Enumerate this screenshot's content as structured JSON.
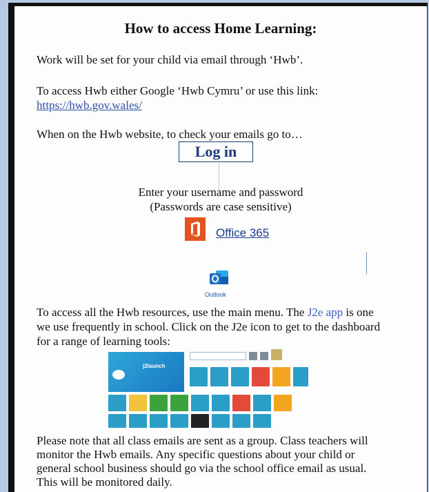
{
  "doc": {
    "title": "How to access Home Learning:",
    "para1": "Work will be set for your child via email through ‘Hwb’.",
    "para2": "To access Hwb either Google ‘Hwb Cymru’ or use this link:",
    "link": "https://hwb.gov.wales/",
    "para3": "When on the Hwb website, to check your emails go to…",
    "login": "Log in",
    "enter": "Enter your username and password",
    "case": "(Passwords are case sensitive)",
    "office": "Office 365",
    "outlook": "Outlook",
    "res_a": "To access all the Hwb resources, use the main menu. The ",
    "res_link": "J2e app",
    "res_b": " is one",
    "res_line2": "we use frequently in school. Click on the J2e icon to get to the dashboard",
    "res_line3": "for a range of learning tools:",
    "dash_title": "j2launch",
    "note_line1": "Please note that all class emails are sent as a group. Class teachers will",
    "note_line2": "monitor the Hwb emails. Any specific questions about your child or",
    "note_line3": "general school business should go via the school office email as usual.",
    "note_line4": "This will be monitored daily."
  },
  "colors": {
    "office_orange": "#e4531f",
    "outlook_blue": "#1f6fc5",
    "link_blue": "#2a4fa8",
    "background_blue": "#b7c9e2"
  },
  "icons": [
    "office-icon",
    "outlook-icon",
    "j2e-dashboard-tiles"
  ]
}
